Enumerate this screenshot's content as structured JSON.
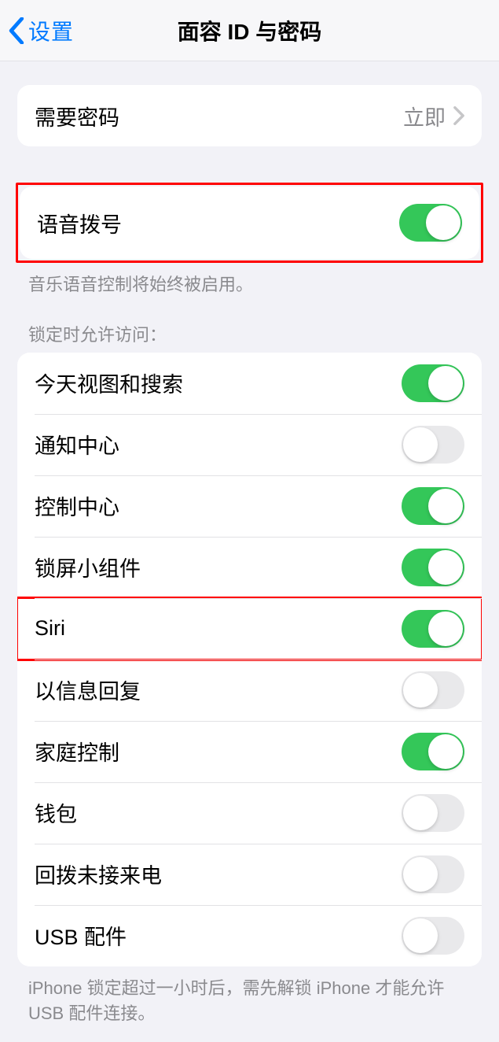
{
  "nav": {
    "back_label": "设置",
    "title": "面容 ID 与密码"
  },
  "passcode": {
    "label": "需要密码",
    "value": "立即"
  },
  "voice_dial": {
    "label": "语音拨号",
    "footer": "音乐语音控制将始终被启用。"
  },
  "locked_access": {
    "header": "锁定时允许访问：",
    "items": [
      {
        "label": "今天视图和搜索",
        "on": true
      },
      {
        "label": "通知中心",
        "on": false
      },
      {
        "label": "控制中心",
        "on": true
      },
      {
        "label": "锁屏小组件",
        "on": true
      },
      {
        "label": "Siri",
        "on": true
      },
      {
        "label": "以信息回复",
        "on": false
      },
      {
        "label": "家庭控制",
        "on": true
      },
      {
        "label": "钱包",
        "on": false
      },
      {
        "label": "回拨未接来电",
        "on": false
      },
      {
        "label": "USB 配件",
        "on": false
      }
    ],
    "footer": "iPhone 锁定超过一小时后，需先解锁 iPhone 才能允许 USB 配件连接。"
  }
}
